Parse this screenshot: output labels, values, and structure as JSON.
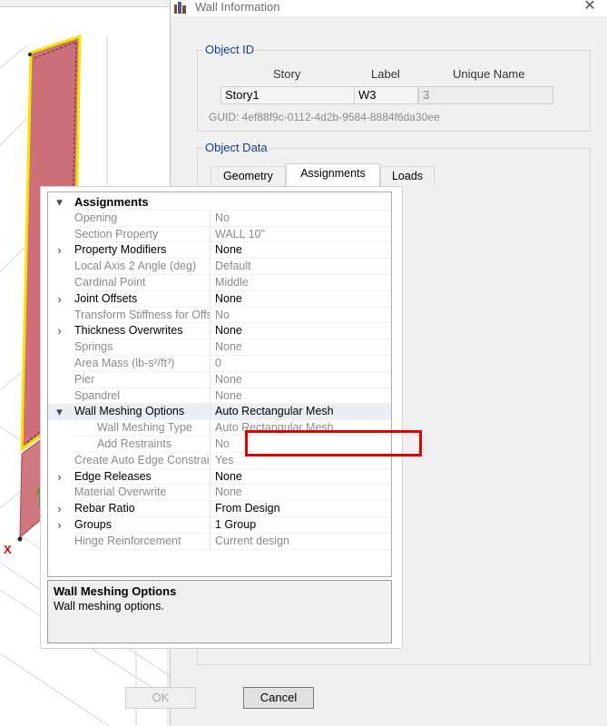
{
  "window": {
    "title": "Wall Information",
    "close_glyph": "✕"
  },
  "object_id": {
    "group_title": "Object ID",
    "headers": {
      "story": "Story",
      "label": "Label",
      "unique_name": "Unique Name"
    },
    "values": {
      "story": "Story1",
      "label": "W3",
      "unique_name": "3"
    },
    "guid": "GUID:  4ef88f9c-0112-4d2b-9584-8884f6da30ee"
  },
  "object_data": {
    "group_title": "Object Data",
    "tabs": [
      {
        "label": "Geometry",
        "active": false
      },
      {
        "label": "Assignments",
        "active": true
      },
      {
        "label": "Loads",
        "active": false
      }
    ],
    "grid": {
      "rows": [
        {
          "expander": "▾",
          "name": "Assignments",
          "value": "",
          "header": true
        },
        {
          "expander": "",
          "name": "Opening",
          "value": "No",
          "readonly": true
        },
        {
          "expander": "",
          "name": "Section Property",
          "value": "WALL 10\"",
          "readonly": true
        },
        {
          "expander": "›",
          "name": "Property Modifiers",
          "value": "None",
          "readonly": false
        },
        {
          "expander": "",
          "name": "Local Axis 2 Angle (deg)",
          "value": "Default",
          "readonly": true
        },
        {
          "expander": "",
          "name": "Cardinal Point",
          "value": "Middle",
          "readonly": true
        },
        {
          "expander": "›",
          "name": "Joint Offsets",
          "value": "None",
          "readonly": false
        },
        {
          "expander": "",
          "name": "Transform Stiffness for Offsets",
          "value": "No",
          "readonly": true
        },
        {
          "expander": "›",
          "name": "Thickness Overwrites",
          "value": "None",
          "readonly": false
        },
        {
          "expander": "",
          "name": "Springs",
          "value": "None",
          "readonly": true
        },
        {
          "expander": "",
          "name": "Area Mass (lb-s²/ft³)",
          "value": "0",
          "readonly": true
        },
        {
          "expander": "",
          "name": "Pier",
          "value": "None",
          "readonly": true
        },
        {
          "expander": "",
          "name": "Spandrel",
          "value": "None",
          "readonly": true
        },
        {
          "expander": "▾",
          "name": "Wall Meshing Options",
          "value": "Auto Rectangular Mesh",
          "readonly": false,
          "selected": true
        },
        {
          "expander": "",
          "name": "Wall Meshing Type",
          "value": "Auto Rectangular Mesh",
          "readonly": true,
          "indent": true
        },
        {
          "expander": "",
          "name": "Add Restraints",
          "value": "No",
          "readonly": true,
          "indent": true
        },
        {
          "expander": "",
          "name": "Create Auto Edge Constraints",
          "value": "Yes",
          "readonly": true
        },
        {
          "expander": "›",
          "name": "Edge Releases",
          "value": "None",
          "readonly": false
        },
        {
          "expander": "",
          "name": "Material Overwrite",
          "value": "None",
          "readonly": true
        },
        {
          "expander": "›",
          "name": "Rebar Ratio",
          "value": "From Design",
          "readonly": false
        },
        {
          "expander": "›",
          "name": "Groups",
          "value": "1 Group",
          "readonly": false
        },
        {
          "expander": "",
          "name": "Hinge Reinforcement",
          "value": "Current design",
          "readonly": true
        }
      ]
    },
    "description": {
      "title": "Wall Meshing Options",
      "text": "Wall meshing options."
    }
  },
  "buttons": {
    "ok": "OK",
    "cancel": "Cancel"
  },
  "viewport": {
    "axis_label": "X"
  },
  "colors": {
    "wall_fill": "#c8606a",
    "wall_outline": "#f5e400",
    "highlight": "#e00000",
    "group_title": "#1a3c8c"
  }
}
